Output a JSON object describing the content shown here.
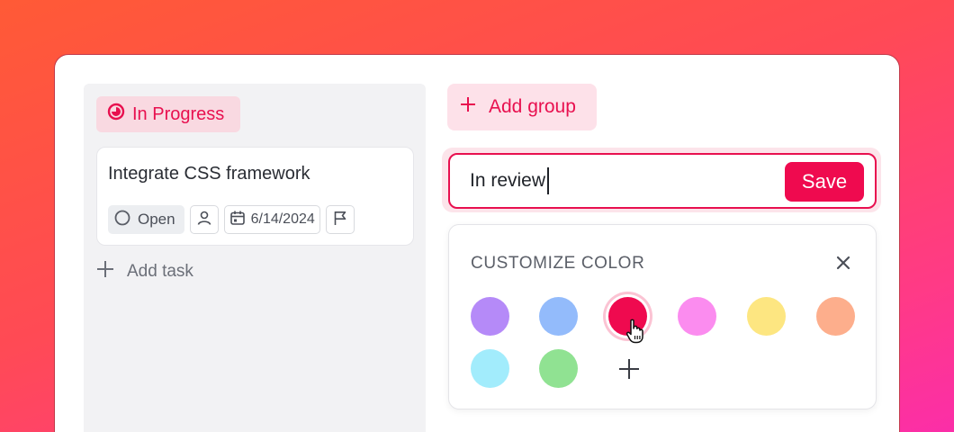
{
  "board": {
    "group": {
      "icon": "progress-icon",
      "label": "In Progress",
      "color": "#e8104f"
    },
    "task": {
      "title": "Integrate CSS framework",
      "status": {
        "icon": "circle-status-icon",
        "label": "Open"
      },
      "assignee_icon": "user-icon",
      "due_date": {
        "icon": "calendar-icon",
        "label": "6/14/2024"
      },
      "priority_icon": "flag-icon"
    },
    "add_task": {
      "icon": "plus-icon",
      "label": "Add task"
    }
  },
  "add_group": {
    "icon": "plus-icon",
    "label": "Add group"
  },
  "group_name_field": {
    "value": "In review",
    "save_label": "Save",
    "accent": "#e8104f"
  },
  "color_picker": {
    "title": "CUSTOMIZE COLOR",
    "close_icon": "close-icon",
    "swatches": [
      {
        "color": "#b58af8",
        "selected": false
      },
      {
        "color": "#93bbfb",
        "selected": false
      },
      {
        "color": "#ef0a4f",
        "selected": true
      },
      {
        "color": "#fb8cef",
        "selected": false
      },
      {
        "color": "#fde681",
        "selected": false
      },
      {
        "color": "#fdae8c",
        "selected": false
      },
      {
        "color": "#a2ecfc",
        "selected": false
      },
      {
        "color": "#90e292",
        "selected": false
      }
    ],
    "add_color_icon": "plus-icon",
    "cursor_icon": "hand-pointer-icon"
  }
}
